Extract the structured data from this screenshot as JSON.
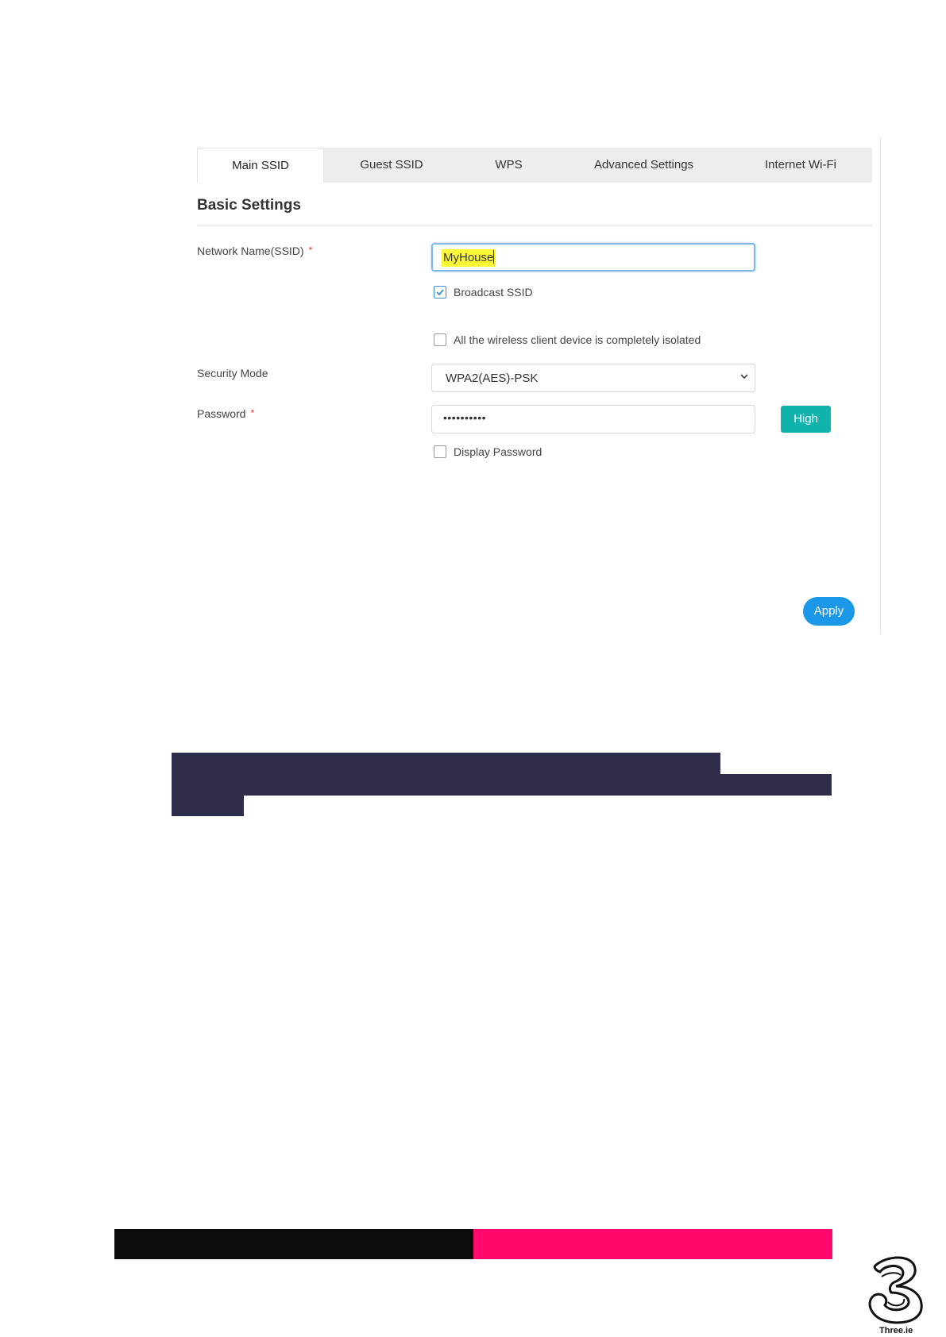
{
  "tabs": [
    {
      "label": "Main SSID",
      "active": true
    },
    {
      "label": "Guest SSID",
      "active": false
    },
    {
      "label": "WPS",
      "active": false
    },
    {
      "label": "Advanced Settings",
      "active": false
    },
    {
      "label": "Internet Wi-Fi",
      "active": false
    }
  ],
  "section": {
    "title": "Basic Settings"
  },
  "network_name": {
    "label": "Network Name(SSID)",
    "required_mark": "*",
    "value": "MyHouse"
  },
  "broadcast_ssid": {
    "label": "Broadcast SSID",
    "checked": true
  },
  "isolation": {
    "label": "All the wireless client device is completely isolated",
    "checked": false
  },
  "security_mode": {
    "label": "Security Mode",
    "value": "WPA2(AES)-PSK"
  },
  "password": {
    "label": "Password",
    "required_mark": "*",
    "masked_value": "••••••••••",
    "strength": "High"
  },
  "display_password": {
    "label": "Display Password",
    "checked": false
  },
  "apply_label": "Apply",
  "footer": {
    "logo_text": "Three.ie"
  },
  "colors": {
    "accent_blue": "#1b99e8",
    "strength_teal": "#12b3ad",
    "highlight_yellow": "#fbf835",
    "redaction_navy": "#2f2e4a",
    "brand_black": "#0c0c0f",
    "brand_pink": "#ff0a6c"
  },
  "icons": [
    "checkbox-checked-icon",
    "checkbox-empty-icon",
    "chevron-down-icon",
    "three-logo-icon"
  ]
}
